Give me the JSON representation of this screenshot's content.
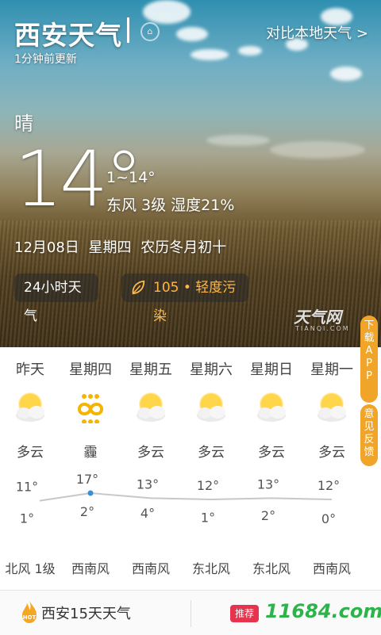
{
  "header": {
    "city": "西安天气",
    "updated": "1分钟前更新",
    "compare_link": "对比本地天气 >"
  },
  "current": {
    "condition": "晴",
    "temperature": "14°",
    "range": "1~14°",
    "wind_humidity": "东风 3级 湿度21%",
    "date_line": "12月08日  星期四  农历冬月初十"
  },
  "buttons": {
    "hourly": "24小时天气",
    "aqi": "105 • 轻度污染"
  },
  "watermark": {
    "brand": "天气网",
    "sub": "TIANQI.COM"
  },
  "side_tabs": {
    "download": "下载APP",
    "feedback": "意见反馈"
  },
  "forecast": [
    {
      "day": "昨天",
      "icon": "partly-cloudy-icon",
      "desc": "多云",
      "high": 11,
      "low": 1,
      "wind": "北风 1级"
    },
    {
      "day": "星期四",
      "icon": "haze-icon",
      "desc": "霾",
      "high": 17,
      "low": 2,
      "wind": "西南风"
    },
    {
      "day": "星期五",
      "icon": "partly-cloudy-icon",
      "desc": "多云",
      "high": 13,
      "low": 4,
      "wind": "西南风"
    },
    {
      "day": "星期六",
      "icon": "partly-cloudy-icon",
      "desc": "多云",
      "high": 12,
      "low": 1,
      "wind": "东北风"
    },
    {
      "day": "星期日",
      "icon": "partly-cloudy-icon",
      "desc": "多云",
      "high": 13,
      "low": 2,
      "wind": "东北风"
    },
    {
      "day": "星期一",
      "icon": "partly-cloudy-icon",
      "desc": "多云",
      "high": 12,
      "low": 0,
      "wind": "西南风"
    }
  ],
  "bottom_bar": {
    "hot_badge": "HOT",
    "link": "西安15天天气",
    "promo_badge": "推荐",
    "site": "11684.com"
  },
  "colors": {
    "accent_orange": "#f0a528",
    "aqi_text": "#ffb74a",
    "promo_red": "#e8334e",
    "site_green": "#2eb34c",
    "chart_line": "#c8c8c8",
    "chart_today_point": "#3a8fd6"
  }
}
